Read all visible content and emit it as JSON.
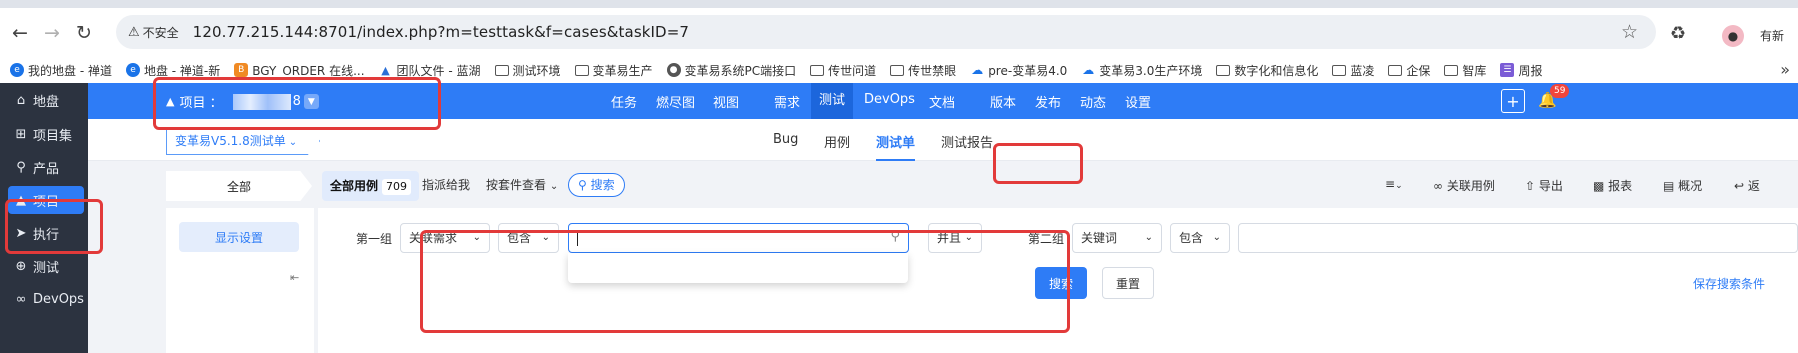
{
  "browser": {
    "security_label": "不安全",
    "url": "120.77.215.144:8701/index.php?m=testtask&f=cases&taskID=7",
    "new_version_label": "有新",
    "icons": [
      "back-icon",
      "forward-icon",
      "reload-icon",
      "warning-icon",
      "star-icon",
      "extensions-icon",
      "profile-icon"
    ]
  },
  "bookmarks": [
    {
      "label": "我的地盘 - 禅道",
      "icon": "globe"
    },
    {
      "label": "地盘 - 禅道-新",
      "icon": "globe"
    },
    {
      "label": "BGY_ORDER 在线...",
      "icon": "orange"
    },
    {
      "label": "团队文件 - 蓝湖",
      "icon": "lanhu"
    },
    {
      "label": "测试环境",
      "icon": "folder"
    },
    {
      "label": "变革易生产",
      "icon": "folder"
    },
    {
      "label": "变革易系统PC端接口",
      "icon": "globe-dark"
    },
    {
      "label": "传世问道",
      "icon": "folder"
    },
    {
      "label": "传世禁眼",
      "icon": "folder"
    },
    {
      "label": "pre-变革易4.0",
      "icon": "cloud"
    },
    {
      "label": "变革易3.0生产环境",
      "icon": "cloud"
    },
    {
      "label": "数字化和信息化",
      "icon": "folder"
    },
    {
      "label": "蓝凌",
      "icon": "folder"
    },
    {
      "label": "企保",
      "icon": "folder"
    },
    {
      "label": "智库",
      "icon": "folder"
    },
    {
      "label": "周报",
      "icon": "purple"
    }
  ],
  "sidebar": {
    "items": [
      {
        "label": "地盘",
        "icon": "home"
      },
      {
        "label": "项目集",
        "icon": "grid"
      },
      {
        "label": "产品",
        "icon": "bulb"
      },
      {
        "label": "项目",
        "icon": "project",
        "active": true
      },
      {
        "label": "执行",
        "icon": "run"
      },
      {
        "label": "测试",
        "icon": "test"
      },
      {
        "label": "DevOps",
        "icon": "devops"
      }
    ]
  },
  "header": {
    "project_label": "项目 ：",
    "project_suffix": "8",
    "menu": [
      "任务",
      "燃尽图",
      "视图",
      "需求",
      "测试",
      "DevOps",
      "文档",
      "版本",
      "发布",
      "动态",
      "设置"
    ],
    "current_menu": "测试",
    "notification_count": "59"
  },
  "subnav": {
    "testrun": "变革易V5.1.8测试单",
    "tabs": [
      "Bug",
      "用例",
      "测试单",
      "测试报告"
    ],
    "current_tab": "测试单"
  },
  "filters": {
    "all_tab": "全部",
    "all_cases_label": "全部用例",
    "all_cases_count": "709",
    "assigned": "指派给我",
    "by_suite": "按套件查看",
    "search": "搜索"
  },
  "toolbar": {
    "link_case": "关联用例",
    "export": "导出",
    "report": "报表",
    "overview": "概况",
    "back": "返"
  },
  "left_panel": {
    "display_settings": "显示设置"
  },
  "search_form": {
    "group1_label": "第一组",
    "field1": "关联需求",
    "operator1": "包含",
    "value1": "",
    "and_or": "并且",
    "group2_label": "第二组",
    "field2": "关键词",
    "operator2": "包含",
    "value2": "",
    "search_button": "搜索",
    "reset_button": "重置",
    "save_search": "保存搜索条件"
  },
  "colors": {
    "primary": "#2e7cf6",
    "sidebar_bg": "#2c3340",
    "annotation_red": "#e23a3a",
    "badge_red": "#f0453c"
  }
}
